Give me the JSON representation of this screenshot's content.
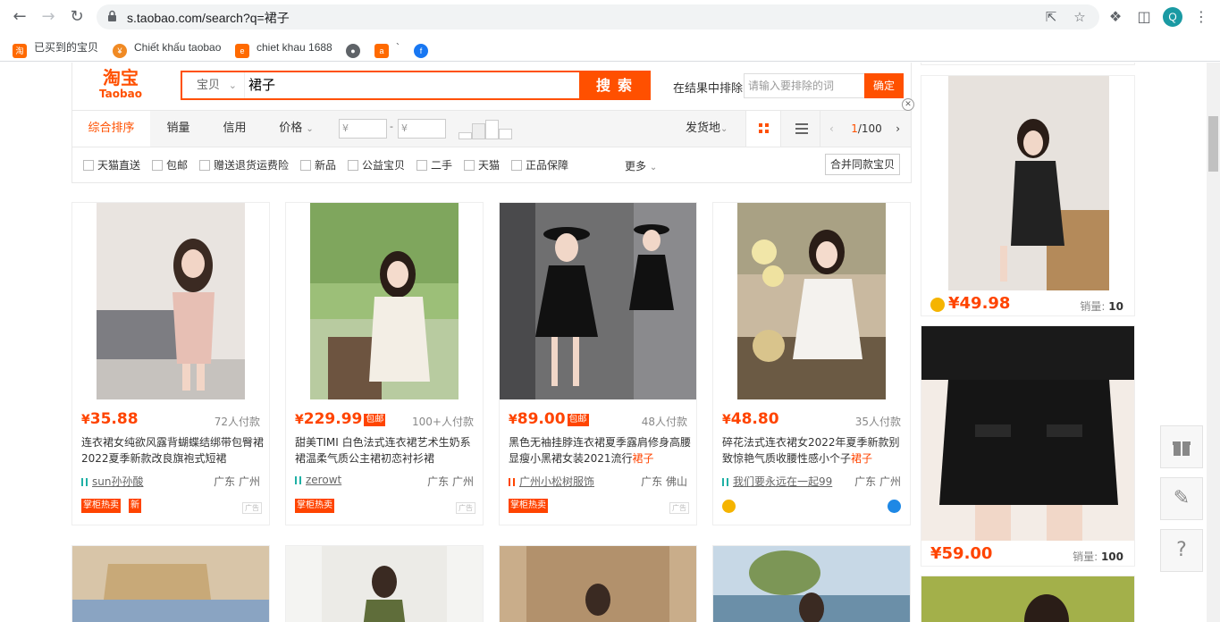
{
  "browser": {
    "url": "s.taobao.com/search?q=裙子",
    "profile_initial": "Q",
    "bookmarks": [
      {
        "label": "已买到的宝贝",
        "icon": "taobao-icon",
        "color": "#ff6a00"
      },
      {
        "label": "Chiết khấu taobao",
        "icon": "coin-icon",
        "color": "#f08a24"
      },
      {
        "label": "chiet khau 1688",
        "icon": "1688-icon",
        "color": "#ff6a00"
      },
      {
        "label": "",
        "icon": "globe-icon",
        "color": "#5f6368"
      },
      {
        "label": "`",
        "icon": "ali-icon",
        "color": "#ff6a00"
      },
      {
        "label": "",
        "icon": "facebook-icon",
        "color": "#1877f2"
      }
    ]
  },
  "header": {
    "logo_cn": "淘宝",
    "logo_en": "Taobao",
    "category": "宝贝",
    "query": "裙子",
    "search_label": "搜索",
    "exclude_label": "在结果中排除",
    "exclude_placeholder": "请输入要排除的词",
    "exclude_confirm": "确定"
  },
  "sortbar": {
    "tabs": [
      "综合排序",
      "销量",
      "信用",
      "价格"
    ],
    "price_from": "¥",
    "price_to": "¥",
    "price_dash": "-",
    "ship_from": "发货地",
    "page_current": "1",
    "page_total": "/100"
  },
  "filters": {
    "items": [
      "天猫直送",
      "包邮",
      "赠送退货运费险",
      "新品",
      "公益宝贝",
      "二手",
      "天猫",
      "正品保障"
    ],
    "more": "更多",
    "merge": "合并同款宝贝"
  },
  "products": [
    {
      "price": "35.88",
      "baoyou": "",
      "deal": "72人付款",
      "title": "连衣裙女纯欲风露背蝴蝶结绑带包臀裙2022夏季新款改良旗袍式短裙",
      "title_hl": "",
      "shop": "sun孙孙酸",
      "loc": "广东 广州",
      "tags": [
        "掌柜热卖",
        "新"
      ],
      "ad": "广告"
    },
    {
      "price": "229.99",
      "baoyou": "包邮",
      "deal": "100+人付款",
      "title": "甜美TIMI 白色法式连衣裙艺术生奶系裙温柔气质公主裙初恋衬衫裙",
      "title_hl": "",
      "shop": "zerowt",
      "loc": "广东 广州",
      "tags": [
        "掌柜热卖"
      ],
      "ad": "广告"
    },
    {
      "price": "89.00",
      "baoyou": "包邮",
      "deal": "48人付款",
      "title": "黑色无袖挂脖连衣裙夏季露肩修身高腰显瘦小黑裙女装2021流行",
      "title_hl": "裙子",
      "shop": "广州小松树服饰",
      "loc": "广东 佛山",
      "tags": [
        "掌柜热卖"
      ],
      "ad": "广告"
    },
    {
      "price": "48.80",
      "baoyou": "",
      "deal": "35人付款",
      "title": "碎花法式连衣裙女2022年夏季新款别致惊艳气质收腰性感小个子",
      "title_hl": "裙子",
      "shop": "我们要永远在一起99",
      "loc": "广东 广州",
      "tags": [],
      "ad": ""
    }
  ],
  "side": [
    {
      "price": "¥49.98",
      "sales_label": "销量:",
      "sales": "10"
    },
    {
      "price": "¥59.00",
      "sales_label": "销量:",
      "sales": "100"
    }
  ],
  "float_buttons": [
    "gift-icon",
    "edit-icon",
    "help-icon"
  ],
  "float_help": "?"
}
